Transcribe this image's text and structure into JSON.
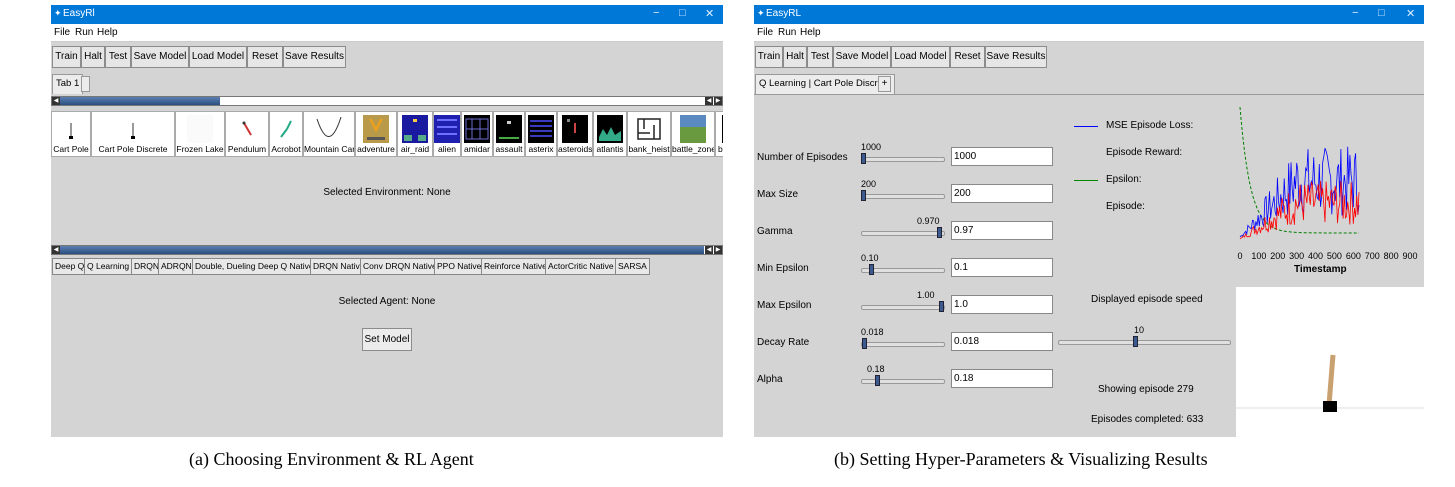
{
  "panelA": {
    "window_title": "EasyRl",
    "window_controls": [
      "−",
      "□",
      "✕"
    ],
    "menu": [
      "File",
      "Run",
      "Help"
    ],
    "toolbar": [
      "Train",
      "Halt",
      "Test",
      "Save Model",
      "Load Model",
      "Reset",
      "Save Results"
    ],
    "tab": "Tab 1",
    "environments": [
      "Cart Pole",
      "Cart Pole Discrete",
      "Frozen Lake",
      "Pendulum",
      "Acrobot",
      "Mountain Car",
      "adventure",
      "air_raid",
      "alien",
      "amidar",
      "assault",
      "asterix",
      "asteroids",
      "atlantis",
      "bank_heist",
      "battle_zone",
      "beam_ri"
    ],
    "selected_environment": "Selected Environment: None",
    "agents": [
      "Deep Q",
      "Q Learning",
      "DRQN",
      "ADRQN",
      "Double, Dueling Deep Q Native",
      "DRQN Native",
      "Conv DRQN Native",
      "PPO Native",
      "Reinforce Native",
      "ActorCritic Native",
      "SARSA"
    ],
    "selected_agent": "Selected Agent: None",
    "set_model": "Set Model"
  },
  "panelB": {
    "window_title": "EasyRL",
    "window_controls": [
      "−",
      "□",
      "✕"
    ],
    "menu": [
      "File",
      "Run",
      "Help"
    ],
    "toolbar": [
      "Train",
      "Halt",
      "Test",
      "Save Model",
      "Load Model",
      "Reset",
      "Save Results"
    ],
    "tab": "Q Learning | Cart Pole Discrete",
    "tab_plus": "+",
    "params": [
      {
        "label": "Number of Episodes",
        "slider_value": "1000",
        "entry": "1000",
        "fraction": 0.0
      },
      {
        "label": "Max Size",
        "slider_value": "200",
        "entry": "200",
        "fraction": 0.0
      },
      {
        "label": "Gamma",
        "slider_value": "0.970",
        "entry": "0.97",
        "fraction": 0.97
      },
      {
        "label": "Min Epsilon",
        "slider_value": "0.10",
        "entry": "0.1",
        "fraction": 0.1
      },
      {
        "label": "Max Epsilon",
        "slider_value": "1.00",
        "entry": "1.0",
        "fraction": 1.0
      },
      {
        "label": "Decay Rate",
        "slider_value": "0.018",
        "entry": "0.018",
        "fraction": 0.018
      },
      {
        "label": "Alpha",
        "slider_value": "0.18",
        "entry": "0.18",
        "fraction": 0.18
      }
    ],
    "legend": {
      "mse_loss": "MSE Episode Loss:",
      "episode_reward": "Episode Reward:",
      "epsilon": "Epsilon:",
      "episode": "Episode:"
    },
    "chart_xticks": [
      "0",
      "100",
      "200",
      "300",
      "400",
      "500",
      "600",
      "700",
      "800",
      "900"
    ],
    "chart_xlabel": "Timestamp",
    "speed": {
      "label": "Displayed episode speed",
      "value": "10",
      "fraction": 0.45
    },
    "showing_episode": "Showing episode 279",
    "episodes_completed": "Episodes completed: 633",
    "colors": {
      "loss": "#0000ff",
      "reward": "#ff0000",
      "epsilon": "#008000"
    }
  },
  "captions": {
    "a": "(a) Choosing Environment & RL Agent",
    "b": "(b) Setting Hyper-Parameters & Visualizing Results"
  }
}
